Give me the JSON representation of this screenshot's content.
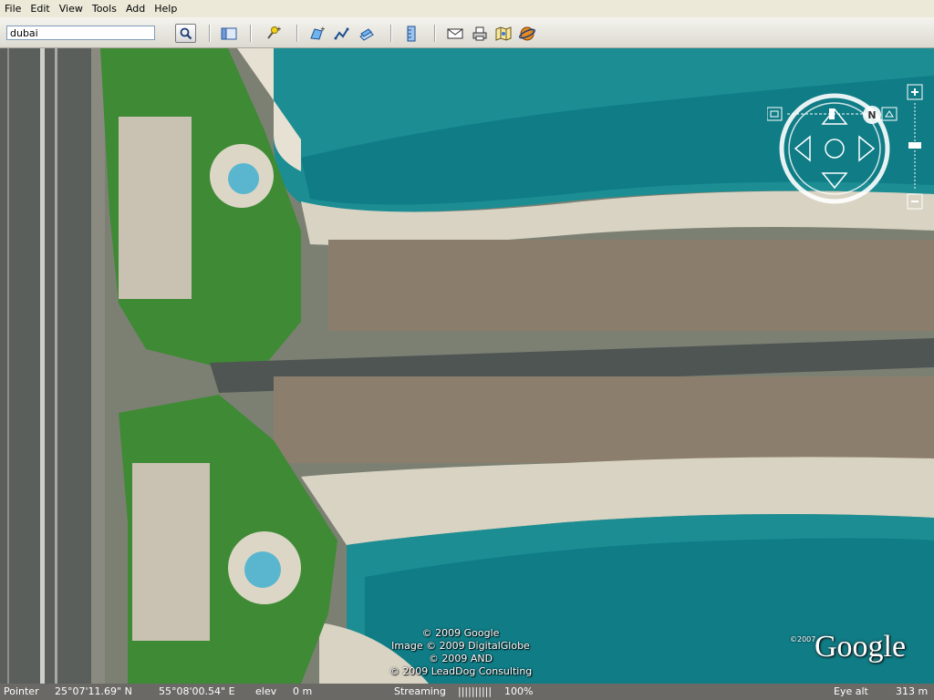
{
  "menu": [
    "File",
    "Edit",
    "View",
    "Tools",
    "Add",
    "Help"
  ],
  "search": {
    "value": "dubai"
  },
  "toolbar_icons": [
    "search-icon",
    "sidebar-icon",
    "placemark-icon",
    "polygon-icon",
    "path-icon",
    "image-overlay-icon",
    "ruler-icon",
    "email-icon",
    "print-icon",
    "maps-icon",
    "sky-icon"
  ],
  "attribution": {
    "lines": [
      "© 2009 Google",
      "Image © 2009 DigitalGlobe",
      "© 2009 AND",
      "© 2009 LeadDog Consulting"
    ],
    "year": "©2007",
    "logo": "Google"
  },
  "status": {
    "pointer_label": "Pointer",
    "lat": "25°07'11.69\" N",
    "lon": "55°08'00.54\" E",
    "elev_label": "elev",
    "elev_value": "0 m",
    "streaming_label": "Streaming",
    "streaming_bar": "||||||||||",
    "streaming_percent": "100%",
    "eye_alt_label": "Eye alt",
    "eye_alt_value": "313 m"
  },
  "nav": {
    "north_label": "N"
  }
}
